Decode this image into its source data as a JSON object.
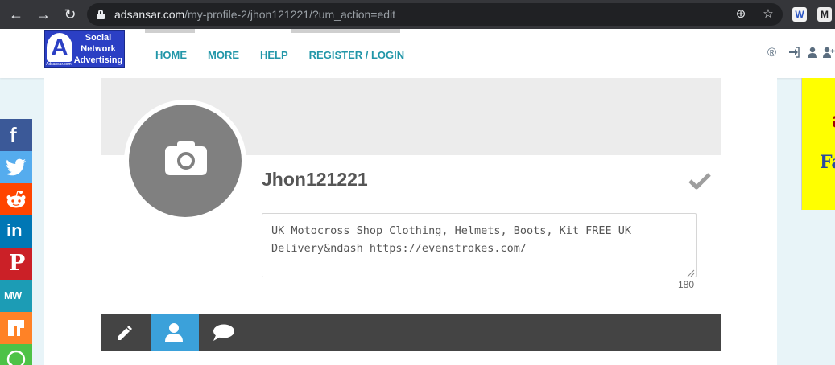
{
  "browser": {
    "url_domain": "adsansar.com",
    "url_path": "/my-profile-2/jhon121221/?um_action=edit"
  },
  "site": {
    "logo_text": "Social Network Advertising",
    "logo_letter": "A",
    "logo_sub": "Adsansar.com",
    "menu": [
      "HOME",
      "MORE",
      "HELP",
      "REGISTER / LOGIN"
    ]
  },
  "profile": {
    "username": "Jhon121221",
    "bio": "UK Motocross Shop Clothing, Helmets, Boots, Kit FREE UK Delivery&ndash https://evenstrokes.com/",
    "char_count": "180"
  },
  "tabs": [
    "edit-icon",
    "user-icon",
    "comment-icon"
  ],
  "social_share": [
    {
      "name": "facebook",
      "color": "#3b5998"
    },
    {
      "name": "twitter",
      "color": "#55acee"
    },
    {
      "name": "reddit",
      "color": "#ff4500"
    },
    {
      "name": "linkedin",
      "color": "#0077b5"
    },
    {
      "name": "pinterest",
      "color": "#cb2027"
    },
    {
      "name": "mewe",
      "color": "#1c9cb5"
    },
    {
      "name": "mix",
      "color": "#ff8226"
    },
    {
      "name": "whatsapp",
      "color": "#4dc247"
    }
  ],
  "ad": {
    "line1": "a",
    "line2": "Fa"
  },
  "colors": {
    "accent": "#2196a8",
    "tab_active": "#3ba1da",
    "tab_bar": "#444444"
  }
}
